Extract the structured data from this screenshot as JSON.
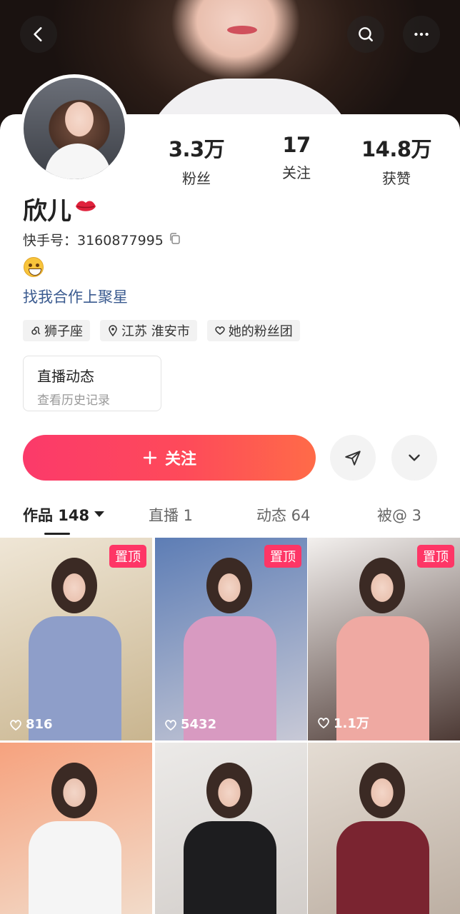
{
  "cover": {
    "back_icon": "chevron-left-icon",
    "search_icon": "search-icon",
    "more_icon": "more-dots-icon"
  },
  "profile": {
    "stats": [
      {
        "value": "3.3万",
        "label": "粉丝"
      },
      {
        "value": "17",
        "label": "关注"
      },
      {
        "value": "14.8万",
        "label": "获赞"
      }
    ],
    "name": "欣儿",
    "id_line": "快手号：3160877995",
    "bio_link": "找我合作上聚星",
    "tags": [
      {
        "icon": "leo-zodiac-icon",
        "label": "狮子座"
      },
      {
        "icon": "location-pin-icon",
        "label": "江苏 淮安市"
      },
      {
        "icon": "heart-outline-icon",
        "label": "她的粉丝团"
      }
    ],
    "live_box": {
      "title": "直播动态",
      "subtitle": "查看历史记录"
    }
  },
  "actions": {
    "follow_label": "关注",
    "share_icon": "send-icon",
    "expand_icon": "chevron-down-icon"
  },
  "tabs": [
    {
      "label": "作品 148"
    },
    {
      "label": "直播 1"
    },
    {
      "label": "动态 64"
    },
    {
      "label": "被@ 3"
    }
  ],
  "grid": {
    "pinned_label": "置顶",
    "tiles": [
      {
        "pinned": true,
        "likes": "816",
        "colors": [
          "#efe6d6",
          "#c9b58f",
          "#8e9ec9"
        ]
      },
      {
        "pinned": true,
        "likes": "5432",
        "colors": [
          "#5d7db5",
          "#c8c9d6",
          "#d89ac1"
        ]
      },
      {
        "pinned": true,
        "likes": "1.1万",
        "colors": [
          "#f3f0ee",
          "#4d3a35",
          "#efa9a2"
        ]
      },
      {
        "pinned": false,
        "likes": "",
        "colors": [
          "#f6a27e",
          "#f1e3d4",
          "#f5f5f5"
        ]
      },
      {
        "pinned": false,
        "likes": "",
        "colors": [
          "#eceae8",
          "#cfcac6",
          "#1d1d1f"
        ]
      },
      {
        "pinned": false,
        "likes": "",
        "colors": [
          "#e4dcd3",
          "#b7a99c",
          "#7a2430"
        ]
      }
    ]
  }
}
